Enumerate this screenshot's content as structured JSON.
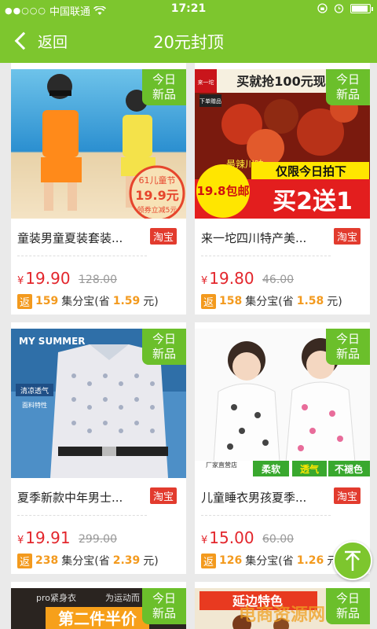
{
  "status": {
    "carrier": "中国联通",
    "time": "17:21",
    "battery_level": 0.9
  },
  "nav": {
    "back_label": "返回",
    "title": "20元封顶"
  },
  "labels": {
    "new_tag_line1": "今日",
    "new_tag_line2": "新品",
    "taobao": "淘宝",
    "yen": "¥",
    "rebate_tag": "返",
    "rebate_unit": "集分宝(省",
    "rebate_close": "元)"
  },
  "products": [
    {
      "title": "童装男童夏装套装...",
      "price": "19.90",
      "original_price": "128.00",
      "rebate_points": "159",
      "save": "1.59",
      "image_texts": [
        "61儿童节",
        "19.9元",
        "领券立减5元"
      ]
    },
    {
      "title": "来一坨四川特产美...",
      "price": "19.80",
      "original_price": "46.00",
      "rebate_points": "158",
      "save": "1.58",
      "image_texts": [
        "来一坨",
        "买就抢100元现",
        "下单赠品",
        "最辣川味",
        "仅限今日拍下",
        "19.8包邮",
        "买2送1"
      ]
    },
    {
      "title": "夏季新款中年男士...",
      "price": "19.91",
      "original_price": "299.00",
      "rebate_points": "238",
      "save": "2.39",
      "image_texts": [
        "MY SUMMER",
        "清凉透气",
        "面料特性"
      ]
    },
    {
      "title": "儿童睡衣男孩夏季...",
      "price": "15.00",
      "original_price": "60.00",
      "rebate_points": "126",
      "save": "1.26",
      "image_texts": [
        "柔软",
        "透气",
        "不褪色",
        "厂家直营店"
      ]
    },
    {
      "image_texts": [
        "pro紧身衣",
        "为运动而",
        "第二件半价"
      ]
    },
    {
      "image_texts": [
        "延边特色"
      ]
    }
  ],
  "watermark": "电商资源网",
  "colors": {
    "brand_green": "#7dc62e",
    "price_red": "#e3262c",
    "taobao_red": "#e23b2e",
    "rebate_orange": "#f39a1e"
  }
}
